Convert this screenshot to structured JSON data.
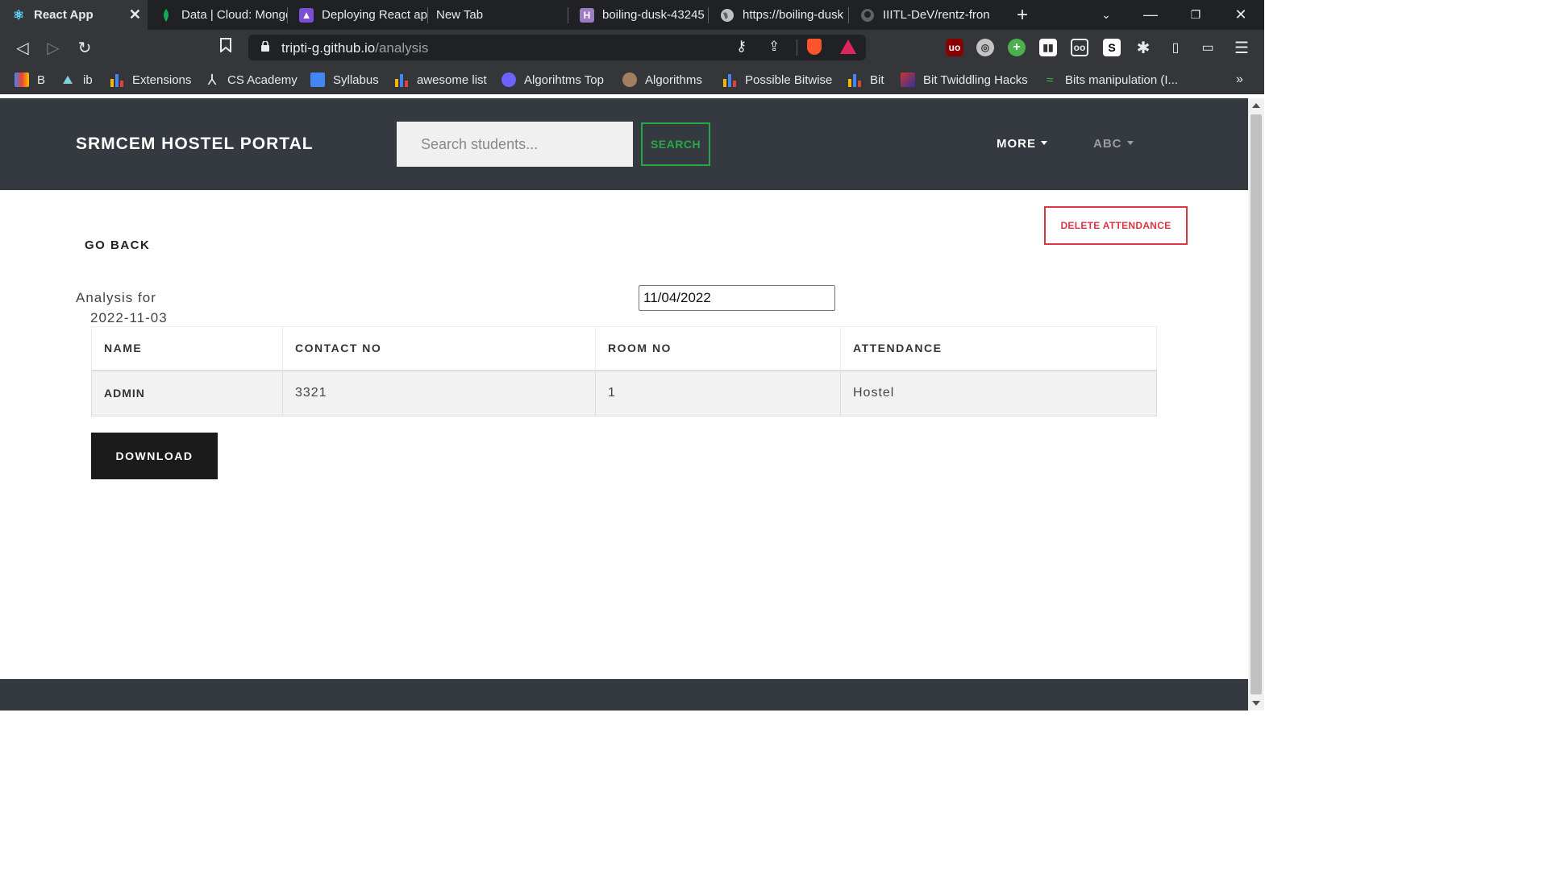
{
  "browser": {
    "tabs": [
      {
        "title": "React App",
        "icon": "react-icon",
        "active": true
      },
      {
        "title": "Data | Cloud: MongoDB",
        "icon": "mongodb-leaf-icon"
      },
      {
        "title": "Deploying React app",
        "icon": "rocket-icon"
      },
      {
        "title": "New Tab",
        "icon": ""
      },
      {
        "title": "boiling-dusk-43245",
        "icon": "heroku-icon"
      },
      {
        "title": "https://boiling-dusk",
        "icon": "globe-icon"
      },
      {
        "title": "IIITL-DeV/rentz-front",
        "icon": "github-icon"
      }
    ],
    "url_host": "tripti-g.github.io",
    "url_path": "/analysis",
    "bookmarks": [
      {
        "label": "B",
        "icon": "gmail-icon"
      },
      {
        "label": "ib",
        "icon": "interviewbit-icon"
      },
      {
        "label": "Extensions",
        "icon": "bar-chart-icon"
      },
      {
        "label": "CS Academy",
        "icon": "cs-academy-icon"
      },
      {
        "label": "Syllabus",
        "icon": "google-docs-icon"
      },
      {
        "label": "awesome list",
        "icon": "bar-chart-icon"
      },
      {
        "label": "Algorihtms Top",
        "icon": "wave-icon"
      },
      {
        "label": "Algorithms",
        "icon": "avatar-icon"
      },
      {
        "label": "Possible Bitwise",
        "icon": "bar-chart-icon"
      },
      {
        "label": "Bit",
        "icon": "bar-chart-icon"
      },
      {
        "label": "Bit Twiddling Hacks",
        "icon": "bookmark-image-icon"
      },
      {
        "label": "Bits manipulation (I...",
        "icon": "dna-icon"
      }
    ],
    "more_bookmarks": "»"
  },
  "navbar": {
    "brand": "SRMCEM HOSTEL PORTAL",
    "search_placeholder": "Search students...",
    "search_button": "SEARCH",
    "more": "MORE",
    "user": "ABC"
  },
  "content": {
    "delete_button": "DELETE ATTENDANCE",
    "go_back": "GO BACK",
    "analysis_label": "Analysis for",
    "analysis_date": "2022-11-03",
    "date_input_value": "11/04/2022",
    "table": {
      "headers": [
        "NAME",
        "CONTACT NO",
        "ROOM NO",
        "ATTENDANCE"
      ],
      "rows": [
        [
          "ADMIN",
          "3321",
          "1",
          "Hostel"
        ]
      ]
    },
    "download_button": "DOWNLOAD"
  },
  "colors": {
    "navbar_bg": "#343a40",
    "success": "#28a745",
    "danger": "#dc3545",
    "dark_button": "#1b1b1b"
  }
}
